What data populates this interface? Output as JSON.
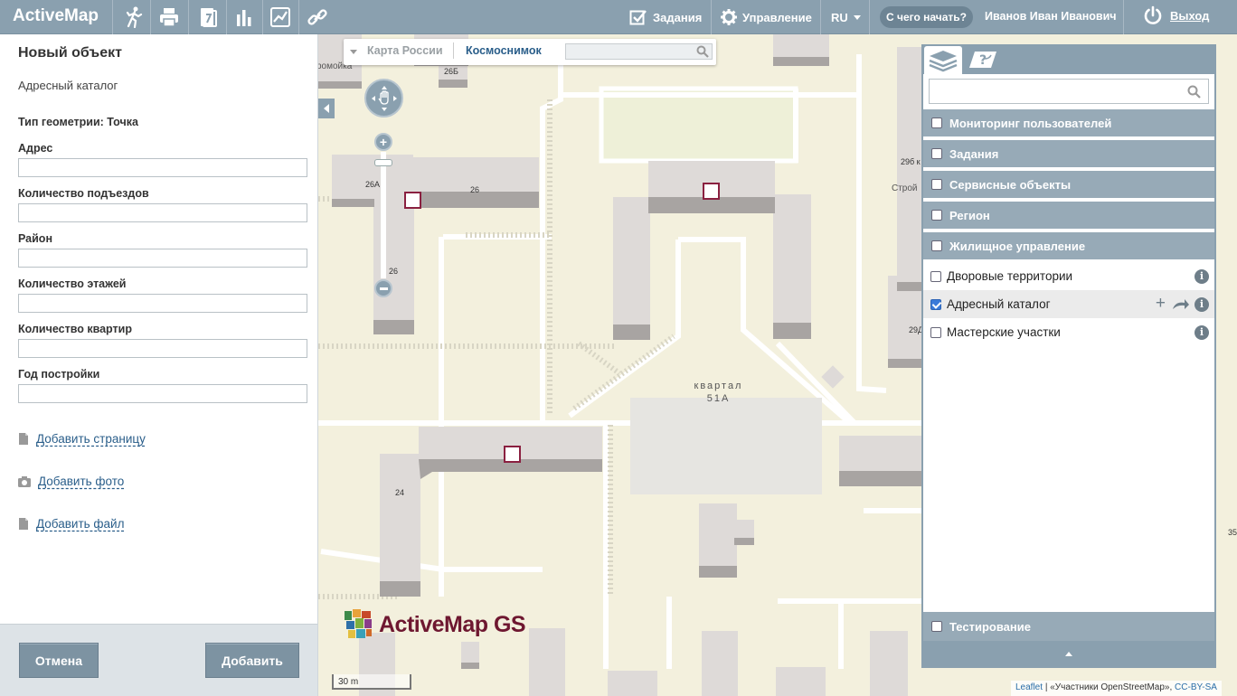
{
  "app": {
    "logo": "ActiveMap"
  },
  "topbar": {
    "icons": [
      "walk-icon",
      "print-icon",
      "report-icon",
      "bar-chart-icon",
      "line-chart-icon",
      "link-icon"
    ],
    "tasks_label": "Задания",
    "manage_label": "Управление",
    "lang_label": "RU",
    "help_label": "С чего начать?",
    "user_name": "Иванов Иван Иванович",
    "exit_label": "Выход"
  },
  "left": {
    "title": "Новый объект",
    "subtitle": "Адресный каталог",
    "geometry": "Тип геометрии: Точка",
    "fields": [
      {
        "label": "Адрес",
        "value": ""
      },
      {
        "label": "Количество подъездов",
        "value": ""
      },
      {
        "label": "Район",
        "value": ""
      },
      {
        "label": "Количество этажей",
        "value": ""
      },
      {
        "label": "Количество квартир",
        "value": ""
      },
      {
        "label": "Год постройки",
        "value": ""
      }
    ],
    "add_page": "Добавить страницу",
    "add_photo": "Добавить фото",
    "add_file": "Добавить файл",
    "cancel": "Отмена",
    "add": "Добавить"
  },
  "map": {
    "switch_russia": "Карта России",
    "switch_sat": "Космоснимок",
    "block_label_1": "квартал",
    "block_label_2": "51А",
    "house_labels": [
      "26Б",
      "26А",
      "26",
      "26",
      "24",
      "29б к",
      "Строй",
      "29Д",
      "35",
      "ромойка"
    ],
    "brand": "ActiveMap GS",
    "scale": "30 m",
    "attr_leaflet": "Leaflet",
    "attr_osm": "«Участники OpenStreetMap»,",
    "attr_license": "CC-BY-SA"
  },
  "layers": {
    "groups_top": [
      {
        "label": "Мониторинг пользователей",
        "checked": false
      },
      {
        "label": "Задания",
        "checked": false
      },
      {
        "label": "Сервисные объекты",
        "checked": false
      },
      {
        "label": "Регион",
        "checked": false
      },
      {
        "label": "Жилищное управление",
        "checked": false
      }
    ],
    "items": [
      {
        "label": "Дворовые территории",
        "checked": false
      },
      {
        "label": "Адресный каталог",
        "checked": true
      },
      {
        "label": "Мастерские участки",
        "checked": false
      }
    ],
    "group_bottom": {
      "label": "Тестирование",
      "checked": false
    }
  },
  "colors": {
    "topbar": "#8aa0af",
    "group_header": "#97aab7",
    "button": "#7d93a2",
    "link": "#2a5e8a",
    "marker": "#8a2040"
  }
}
